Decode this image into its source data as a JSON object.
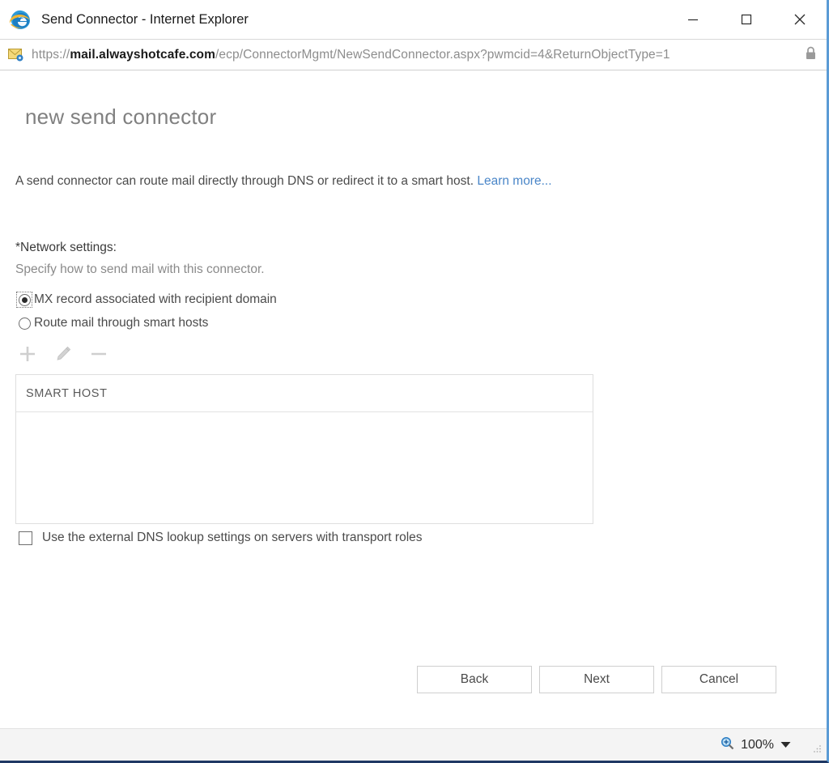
{
  "window": {
    "title": "Send Connector - Internet Explorer",
    "app_icon": "internet-explorer-logo",
    "controls": {
      "minimize": "–",
      "maximize": "☐",
      "close": "✕"
    }
  },
  "address_bar": {
    "favicon": "exchange-mail-gear-icon",
    "scheme": "https://",
    "domain": "mail.alwayshotcafe.com",
    "path": "/ecp/ConnectorMgmt/NewSendConnector.aspx?pwmcid=4&ReturnObjectType=1",
    "full_url": "https://mail.alwayshotcafe.com/ecp/ConnectorMgmt/NewSendConnector.aspx?pwmcid=4&ReturnObjectType=1",
    "security_icon": "lock-icon"
  },
  "page": {
    "title": "new send connector",
    "description": "A send connector can route mail directly through DNS or redirect it to a smart host.",
    "learn_more_label": "Learn more...",
    "network_settings": {
      "label": "*Network settings:",
      "sublabel": "Specify how to send mail with this connector.",
      "options": [
        {
          "label": "MX record associated with recipient domain",
          "selected": true,
          "focused": true
        },
        {
          "label": "Route mail through smart hosts",
          "selected": false,
          "focused": false
        }
      ]
    },
    "list_toolbar": [
      {
        "name": "add",
        "glyph": "plus-icon",
        "enabled": false
      },
      {
        "name": "edit",
        "glyph": "pencil-icon",
        "enabled": false
      },
      {
        "name": "remove",
        "glyph": "minus-icon",
        "enabled": false
      }
    ],
    "smart_host_list": {
      "column_header": "SMART HOST",
      "rows": []
    },
    "dns_checkbox": {
      "label": "Use the external DNS lookup settings on servers with transport roles",
      "checked": false
    },
    "buttons": [
      {
        "label": "Back",
        "name": "back"
      },
      {
        "label": "Next",
        "name": "next"
      },
      {
        "label": "Cancel",
        "name": "cancel"
      }
    ]
  },
  "status_bar": {
    "zoom_icon": "zoom-magnifier-icon",
    "zoom_level": "100%",
    "dropdown_icon": "chevron-down-icon",
    "resize_grip": "resize-grip-icon"
  },
  "colors": {
    "link": "#4a86c8",
    "title_text": "#808080",
    "body_text": "#4b4b4b",
    "muted_text": "#8a8a8a",
    "border": "#dedede",
    "statusbar_bg": "#f4f4f4"
  }
}
